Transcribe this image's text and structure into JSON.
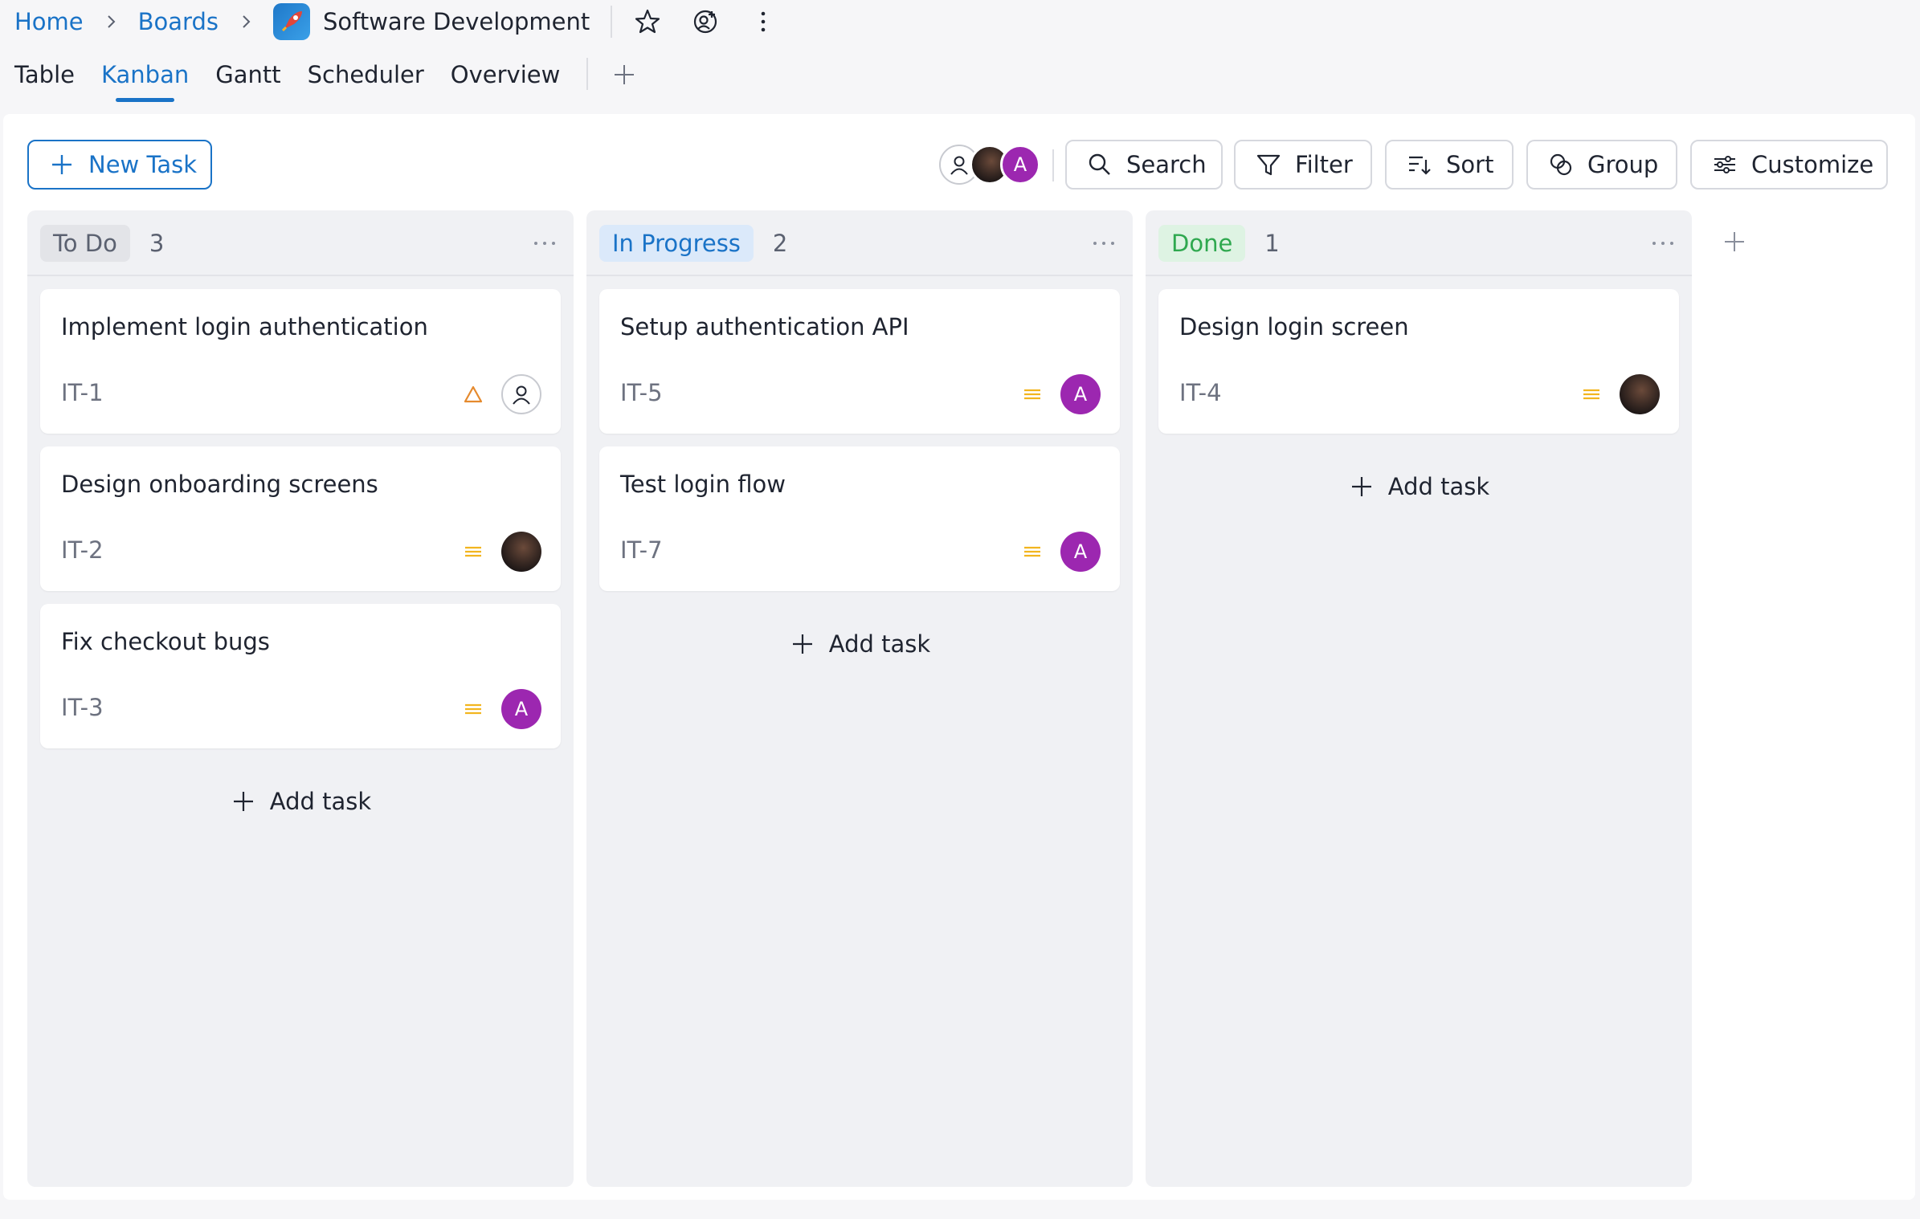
{
  "breadcrumb": {
    "home": "Home",
    "boards": "Boards",
    "current": "Software Development"
  },
  "tabs": [
    {
      "label": "Table",
      "active": false
    },
    {
      "label": "Kanban",
      "active": true
    },
    {
      "label": "Gantt",
      "active": false
    },
    {
      "label": "Scheduler",
      "active": false
    },
    {
      "label": "Overview",
      "active": false
    }
  ],
  "toolbar": {
    "new_task": "New Task",
    "search": "Search",
    "filter": "Filter",
    "sort": "Sort",
    "group": "Group",
    "customize": "Customize",
    "avatar_initial": "A"
  },
  "colors": {
    "accent": "#1a73c7",
    "avatar_purple": "#9c27b0",
    "priority_medium": "#f2b51f",
    "priority_high": "#e58a2e",
    "done_green": "#2fa84f",
    "progress_blue": "#1a73c7"
  },
  "columns": [
    {
      "name": "To Do",
      "count": "3",
      "add_label": "Add task",
      "cards": [
        {
          "title": "Implement login authentication",
          "id": "IT-1",
          "priority": "high",
          "assignee": "user-icon"
        },
        {
          "title": "Design onboarding screens",
          "id": "IT-2",
          "priority": "medium",
          "assignee": "photo"
        },
        {
          "title": "Fix checkout bugs",
          "id": "IT-3",
          "priority": "medium",
          "assignee": "A"
        }
      ]
    },
    {
      "name": "In Progress",
      "count": "2",
      "add_label": "Add task",
      "cards": [
        {
          "title": "Setup authentication API",
          "id": "IT-5",
          "priority": "medium",
          "assignee": "A"
        },
        {
          "title": "Test login flow",
          "id": "IT-7",
          "priority": "medium",
          "assignee": "A"
        }
      ]
    },
    {
      "name": "Done",
      "count": "1",
      "add_label": "Add task",
      "cards": [
        {
          "title": "Design login screen",
          "id": "IT-4",
          "priority": "medium",
          "assignee": "photo"
        }
      ]
    }
  ]
}
